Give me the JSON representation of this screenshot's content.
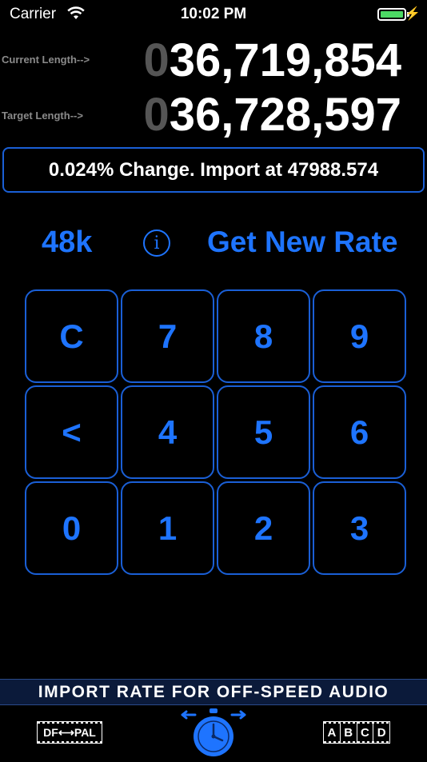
{
  "status_bar": {
    "carrier": "Carrier",
    "time": "10:02 PM",
    "battery_color": "#4cd964"
  },
  "lengths": {
    "current_label": "Current Length-->",
    "current_lead": "0",
    "current_value": "36,719,854",
    "target_label": "Target Length-->",
    "target_lead": "0",
    "target_value": "36,728,597"
  },
  "result_text": "0.024% Change. Import at 47988.574",
  "controls": {
    "rate_label": "48k",
    "info_icon": "info-icon",
    "get_rate_label": "Get New Rate"
  },
  "keypad": {
    "keys": [
      "C",
      "7",
      "8",
      "9",
      "<",
      "4",
      "5",
      "6",
      "0",
      "1",
      "2",
      "3"
    ]
  },
  "banner_text": "IMPORT RATE FOR OFF-SPEED AUDIO",
  "tabbar": {
    "df_pal": {
      "left": "DF",
      "right": "PAL",
      "icon": "df-pal-convert-icon"
    },
    "center_icon": "stopwatch-icon",
    "abcd": {
      "letters": [
        "A",
        "B",
        "C",
        "D"
      ],
      "icon": "film-frames-icon"
    }
  },
  "colors": {
    "accent": "#1e74ff",
    "border": "#1a5fd6",
    "dim_digit": "#555555",
    "label_gray": "#8a8a8a",
    "banner_bg": "#0b1a3a"
  }
}
